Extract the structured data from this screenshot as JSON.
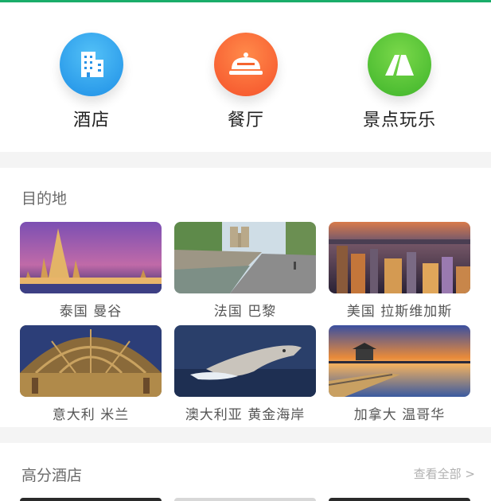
{
  "categories": [
    {
      "label": "酒店",
      "icon": "building-icon",
      "color": "#2196e8"
    },
    {
      "label": "餐厅",
      "icon": "food-cloche-icon",
      "color": "#f6562c"
    },
    {
      "label": "景点玩乐",
      "icon": "mountain-icon",
      "color": "#44b52e"
    }
  ],
  "destinations": {
    "title": "目的地",
    "items": [
      {
        "label": "泰国 曼谷",
        "image": "bangkok-temple-photo"
      },
      {
        "label": "法国 巴黎",
        "image": "paris-notre-dame-photo"
      },
      {
        "label": "美国 拉斯维加斯",
        "image": "las-vegas-night-photo"
      },
      {
        "label": "意大利 米兰",
        "image": "milan-galleria-photo"
      },
      {
        "label": "澳大利亚 黄金海岸",
        "image": "gold-coast-whale-photo"
      },
      {
        "label": "加拿大 温哥华",
        "image": "vancouver-sunset-photo"
      }
    ]
  },
  "hotels": {
    "title": "高分酒店",
    "view_all": "查看全部 >"
  },
  "colors": {
    "accent": "#1aad6a"
  }
}
